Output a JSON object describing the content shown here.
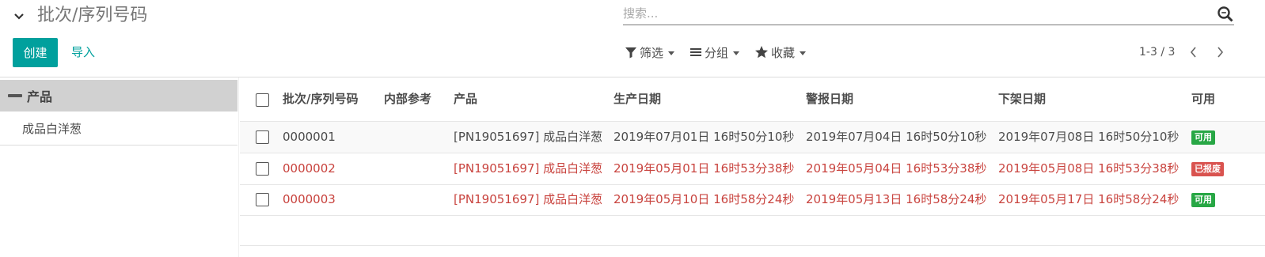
{
  "breadcrumb": {
    "title": "批次/序列号码"
  },
  "search": {
    "placeholder": "搜索..."
  },
  "buttons": {
    "create": "创建",
    "import": "导入"
  },
  "toolbar": {
    "filter": "筛选",
    "group": "分组",
    "favorites": "收藏"
  },
  "pager": {
    "value": "1-3 / 3"
  },
  "sidebar": {
    "header": "产品",
    "items": [
      {
        "label": "成品白洋葱"
      }
    ]
  },
  "table": {
    "columns": [
      "批次/序列号码",
      "内部参考",
      "产品",
      "生产日期",
      "警报日期",
      "下架日期",
      "可用"
    ],
    "rows": [
      {
        "lot": "0000001",
        "ref": "",
        "product": "[PN19051697] 成品白洋葱",
        "prod_date": "2019年07月01日 16时50分10秒",
        "alert_date": "2019年07月04日 16时50分10秒",
        "removal_date": "2019年07月08日 16时50分10秒",
        "status": "可用",
        "status_color": "#28a745",
        "text_color": "#4c4c4c"
      },
      {
        "lot": "0000002",
        "ref": "",
        "product": "[PN19051697] 成品白洋葱",
        "prod_date": "2019年05月01日 16时53分38秒",
        "alert_date": "2019年05月04日 16时53分38秒",
        "removal_date": "2019年05月08日 16时53分38秒",
        "status": "已报废",
        "status_color": "#d9534f",
        "text_color": "#c9443f"
      },
      {
        "lot": "0000003",
        "ref": "",
        "product": "[PN19051697] 成品白洋葱",
        "prod_date": "2019年05月10日 16时58分24秒",
        "alert_date": "2019年05月13日 16时58分24秒",
        "removal_date": "2019年05月17日 16时58分24秒",
        "status": "可用",
        "status_color": "#28a745",
        "text_color": "#c9443f"
      }
    ]
  },
  "colors": {
    "accent": "#00a09d",
    "danger_text": "#c9443f",
    "success_badge": "#28a745",
    "danger_badge": "#d9534f"
  }
}
